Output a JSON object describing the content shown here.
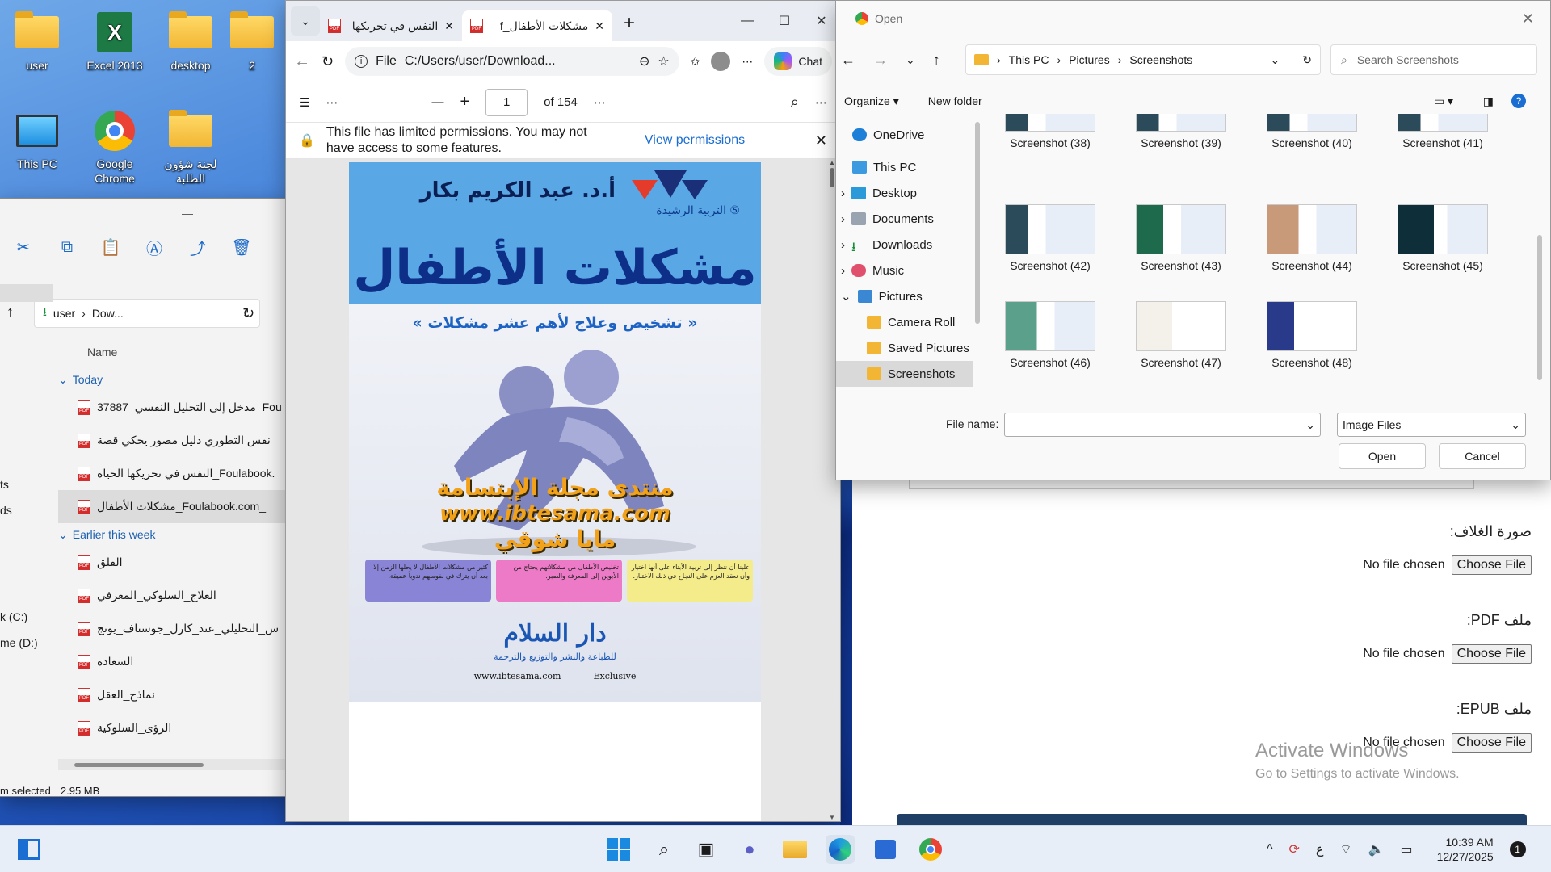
{
  "desktop": {
    "icons": [
      "user",
      "Excel 2013",
      "desktop",
      "2",
      "This PC",
      "Google Chrome",
      "لجنة شؤون الطلبة"
    ]
  },
  "explorer": {
    "breadcrumb": [
      "user",
      "Dow..."
    ],
    "column_header": "Name",
    "groups": {
      "today": "Today",
      "earlier": "Earlier this week"
    },
    "today_files": [
      "37887_مدخل إلى التحليل النفسي_Fou",
      "نفس التطوري دليل مصور يحكي قصة",
      "النفس في تحريكها الحياة_Foulabook.",
      "مشكلات الأطفال_Foulabook.com_"
    ],
    "earlier_files": [
      "القلق",
      "العلاج_السلوكي_المعرفي",
      "س_التحليلي_عند_كارل_جوستاف_يونج",
      "السعادة",
      "نماذج_العقل",
      "الرؤى_السلوكية"
    ],
    "left_nav": [
      "ts",
      "ds",
      "k (C:)",
      "me (D:)"
    ],
    "status_selected": "m selected",
    "status_size": "2.95 MB"
  },
  "edge": {
    "tabs": [
      {
        "label": "النفس في تحريكها"
      },
      {
        "label": "مشكلات الأطفال_f"
      }
    ],
    "url_prefix": "File",
    "url": "C:/Users/user/Download...",
    "chat_label": "Chat",
    "page_current": "1",
    "page_total": "of 154",
    "permission_msg_line1": "This file has limited permissions. You may not",
    "permission_msg_line2": "have access to some features.",
    "view_permissions": "View permissions"
  },
  "pdf_cover": {
    "author": "أ.د. عبد الكريم بكار",
    "series": "التربية الرشيدة ⑤",
    "title": "مشكلات الأطفال",
    "subtitle": "« تشخيص وعلاج لأهم عشر مشكلات »",
    "watermark1": "منتدى مجلة الإبتسامة",
    "watermark2": "www.ibtesama.com",
    "watermark3": "مايا شوقي",
    "box1": "كثير من مشكلات الأطفال لا يحلها الزمن إلا بعد أن يترك في نفوسهم ندوباً عميقة.",
    "box2": "تخليص الأطفال من مشكلاتهم يحتاج من الأبوين إلى المعرفة والصبر.",
    "box3": "علينا أن ننظر إلى تربية الأبناء على أنها اختبار وأن نعقد العزم على النجاح في ذلك الاختبار.",
    "publisher": "دار السلام",
    "publisher_sub": "للطباعة والنشر والتوزيع والترجمة",
    "footer_site": "www.ibtesama.com",
    "footer_tag": "Exclusive"
  },
  "open_dialog": {
    "title": "Open",
    "breadcrumb": [
      "This PC",
      "Pictures",
      "Screenshots"
    ],
    "search_placeholder": "Search Screenshots",
    "organize": "Organize",
    "new_folder": "New folder",
    "tree": [
      "OneDrive",
      "This PC",
      "Desktop",
      "Documents",
      "Downloads",
      "Music",
      "Pictures",
      "Camera Roll",
      "Saved Pictures",
      "Screenshots"
    ],
    "thumbs": [
      "Screenshot (38)",
      "Screenshot (39)",
      "Screenshot (40)",
      "Screenshot (41)",
      "Screenshot (42)",
      "Screenshot (43)",
      "Screenshot (44)",
      "Screenshot (45)",
      "Screenshot (46)",
      "Screenshot (47)",
      "Screenshot (48)"
    ],
    "file_name_label": "File name:",
    "file_name_value": "",
    "file_type": "Image Files",
    "open_btn": "Open",
    "cancel_btn": "Cancel"
  },
  "webform": {
    "cover_label": "صورة الغلاف:",
    "pdf_label": "ملف PDF:",
    "epub_label": "ملف EPUB:",
    "no_file": "No file chosen",
    "choose": "Choose File"
  },
  "watermark": {
    "line1": "Activate Windows",
    "line2": "Go to Settings to activate Windows."
  },
  "taskbar": {
    "time": "10:39 AM",
    "date": "12/27/2025",
    "lang": "ع",
    "badge": "1"
  }
}
